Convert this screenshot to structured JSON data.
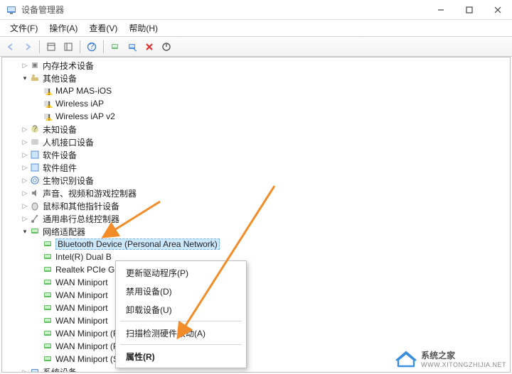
{
  "window": {
    "title": "设备管理器",
    "menu": {
      "file": "文件(F)",
      "action": "操作(A)",
      "view": "查看(V)",
      "help": "帮助(H)"
    }
  },
  "tree": {
    "memory": "内存技术设备",
    "other": "其他设备",
    "other_items": [
      "MAP MAS-iOS",
      "Wireless iAP",
      "Wireless iAP v2"
    ],
    "unknown": "未知设备",
    "hid": "人机接口设备",
    "software_dev": "软件设备",
    "software_comp": "软件组件",
    "biometric": "生物识别设备",
    "sound": "声音、视频和游戏控制器",
    "mouse": "鼠标和其他指针设备",
    "usb": "通用串行总线控制器",
    "network": "网络适配器",
    "net_items": [
      "Bluetooth Device (Personal Area Network)",
      "Intel(R) Dual B",
      "Realtek PCIe G",
      "WAN Miniport",
      "WAN Miniport",
      "WAN Miniport",
      "WAN Miniport",
      "WAN Miniport (PPPOE)",
      "WAN Miniport (PPTP)",
      "WAN Miniport (SSTP)"
    ],
    "system": "系统设备"
  },
  "context": {
    "update": "更新驱动程序(P)",
    "disable": "禁用设备(D)",
    "uninstall": "卸载设备(U)",
    "scan": "扫描检测硬件改动(A)",
    "properties": "属性(R)"
  },
  "watermark": {
    "text": "系统之家",
    "url": "WWW.XITONGZHIJIA.NET"
  }
}
